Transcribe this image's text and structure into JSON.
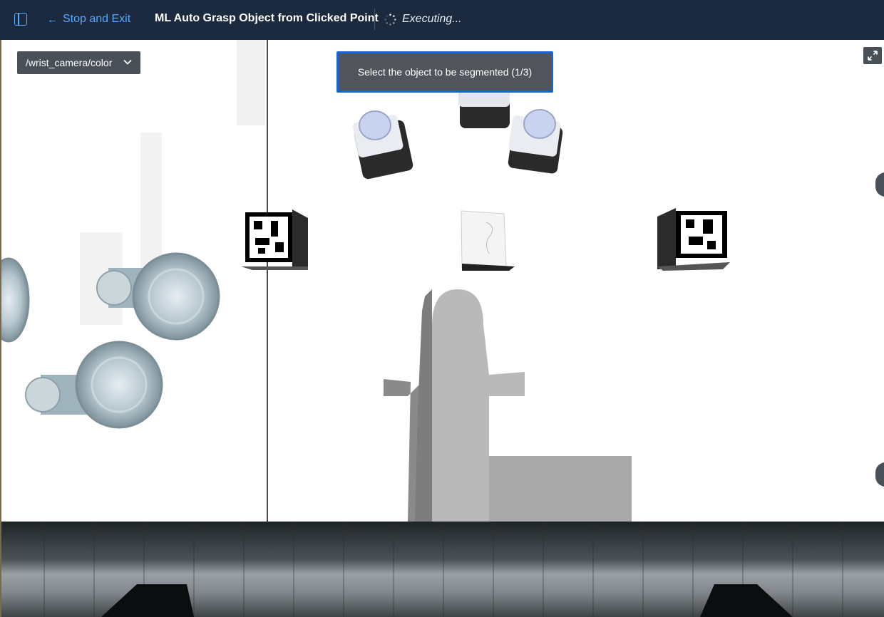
{
  "header": {
    "back_label": "Stop and Exit",
    "title": "ML Auto Grasp Object from Clicked Point",
    "status": "Executing..."
  },
  "viewer": {
    "camera_topic": "/wrist_camera/color",
    "prompt": "Select the object to be segmented (1/3)"
  },
  "colors": {
    "topbar": "#1b2a3e",
    "accent": "#5aa9ff",
    "prompt_border": "#1565d8"
  }
}
